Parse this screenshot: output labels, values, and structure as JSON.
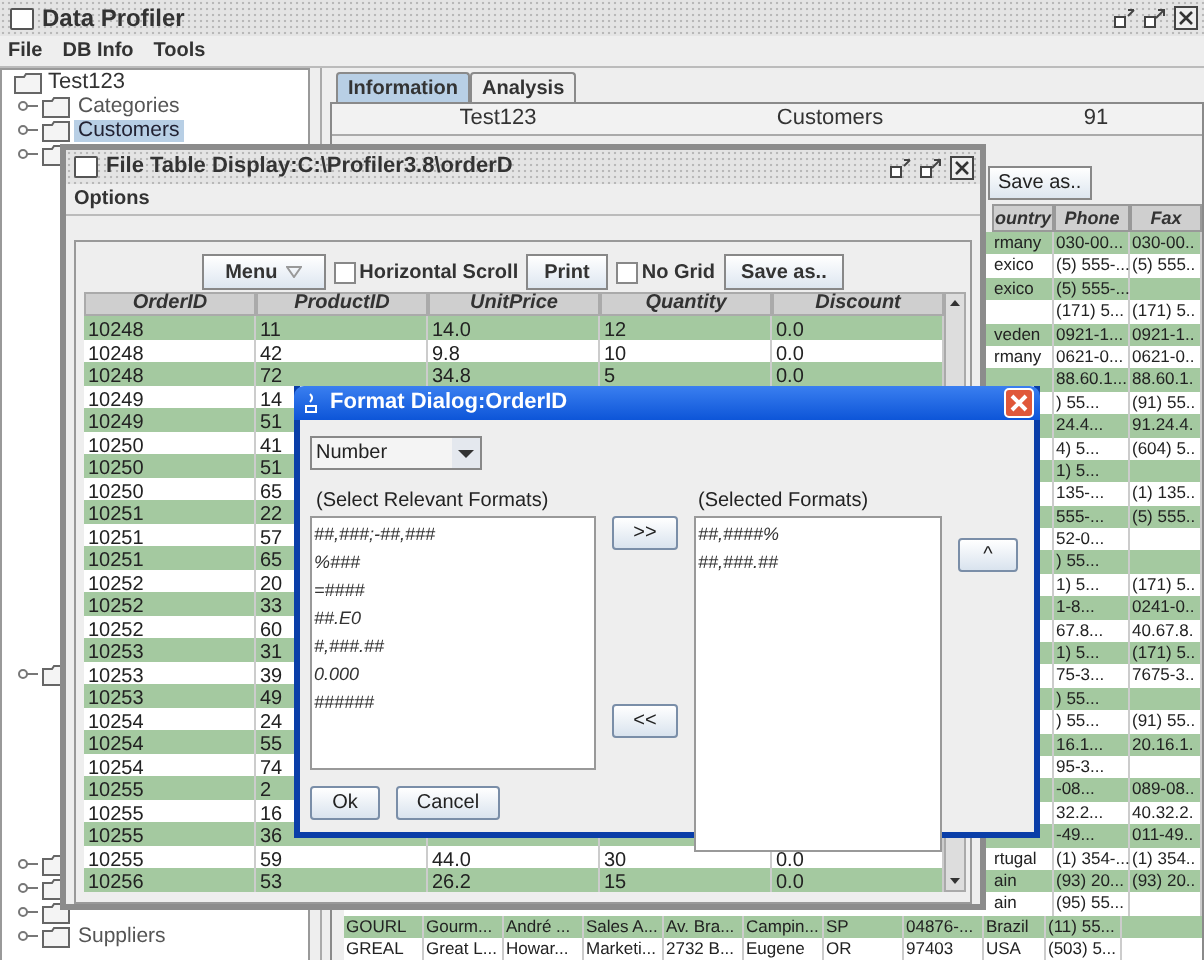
{
  "window": {
    "title": "Data Profiler"
  },
  "menu": [
    "File",
    "DB Info",
    "Tools"
  ],
  "tree": {
    "label": "Test123",
    "children": [
      {
        "label": "Categories",
        "selected": false
      },
      {
        "label": "Customers",
        "selected": true
      },
      {
        "selected": false
      },
      {
        "selected": false
      },
      {
        "selected": false
      },
      {
        "selected": false
      },
      {
        "selected": false
      },
      {
        "label": "Suppliers",
        "selected": false
      }
    ]
  },
  "info_tabs": [
    {
      "label": "Information",
      "selected": true
    },
    {
      "label": "Analysis",
      "selected": false
    }
  ],
  "summary": [
    "Test123",
    "Customers",
    "91"
  ],
  "customer_table": {
    "save_button": "Save as..",
    "columns": [
      "ountry",
      "Phone",
      "Fax"
    ],
    "rows": [
      {
        "country": "rmany",
        "phone": "030-00...",
        "fax": "030-00.."
      },
      {
        "country": "exico",
        "phone": "(5) 555-...",
        "fax": "(5) 555.."
      },
      {
        "country": "exico",
        "phone": "(5) 555-..."
      },
      {
        "phone": "(171) 5...",
        "fax": "(171) 5.."
      },
      {
        "country": "veden",
        "phone": "0921-1...",
        "fax": "0921-1.."
      },
      {
        "country": "rmany",
        "phone": "0621-0...",
        "fax": "0621-0.."
      },
      {
        "phone": "88.60.1...",
        "fax": "88.60.1."
      },
      {
        "phone": ") 55...",
        "fax": "(91) 55.."
      },
      {
        "phone": "24.4...",
        "fax": "91.24.4."
      },
      {
        "phone": "4) 5...",
        "fax": "(604) 5.."
      },
      {
        "phone": "1) 5..."
      },
      {
        "phone": "135-...",
        "fax": "(1) 135.."
      },
      {
        "phone": "555-...",
        "fax": "(5) 555.."
      },
      {
        "phone": "52-0..."
      },
      {
        "phone": ") 55..."
      },
      {
        "phone": "1) 5...",
        "fax": "(171) 5.."
      },
      {
        "phone": "1-8...",
        "fax": "0241-0.."
      },
      {
        "phone": "67.8...",
        "fax": "40.67.8."
      },
      {
        "phone": "1) 5...",
        "fax": "(171) 5.."
      },
      {
        "phone": "75-3...",
        "fax": "7675-3.."
      },
      {
        "phone": ") 55..."
      },
      {
        "phone": ") 55...",
        "fax": "(91) 55.."
      },
      {
        "phone": "16.1...",
        "fax": "20.16.1."
      },
      {
        "phone": "95-3..."
      },
      {
        "phone": "-08...",
        "fax": "089-08.."
      },
      {
        "phone": "32.2...",
        "fax": "40.32.2."
      },
      {
        "phone": "-49...",
        "fax": "011-49.."
      },
      {
        "country": "rtugal",
        "phone": "(1) 354-...",
        "fax": "(1) 354.."
      },
      {
        "country": "ain",
        "phone": "(93) 20...",
        "fax": "(93) 20.."
      },
      {
        "country": "ain",
        "phone": "(95) 55..."
      }
    ],
    "full_rows": [
      [
        "GOURL",
        "Gourm...",
        "André ...",
        "Sales A...",
        "Av. Bra...",
        "Campin...",
        "SP",
        "04876-...",
        "Brazil",
        "(11) 55..."
      ],
      [
        "GREAL",
        "Great L...",
        "Howar...",
        "Marketi...",
        "2732 B...",
        "Eugene",
        "OR",
        "97403",
        "USA",
        "(503) 5..."
      ]
    ]
  },
  "table_frame": {
    "title": "File Table Display:C:\\Profiler3.8\\orderD",
    "menu": "Options",
    "toolbar": [
      {
        "kind": "menu",
        "label": "Menu"
      },
      {
        "kind": "check",
        "label": "Horizontal Scroll",
        "checked": false
      },
      {
        "kind": "button",
        "label": "Print"
      },
      {
        "kind": "check",
        "label": "No Grid",
        "checked": false
      },
      {
        "kind": "button",
        "label": "Save as.."
      }
    ],
    "columns": [
      "OrderID",
      "ProductID",
      "UnitPrice",
      "Quantity",
      "Discount"
    ],
    "rows": [
      [
        "10248",
        "11",
        "14.0",
        "12",
        "0.0"
      ],
      [
        "10248",
        "42",
        "9.8",
        "10",
        "0.0"
      ],
      [
        "10248",
        "72",
        "34.8",
        "5",
        "0.0"
      ],
      [
        "10249",
        "14"
      ],
      [
        "10249",
        "51"
      ],
      [
        "10250",
        "41"
      ],
      [
        "10250",
        "51"
      ],
      [
        "10250",
        "65"
      ],
      [
        "10251",
        "22"
      ],
      [
        "10251",
        "57"
      ],
      [
        "10251",
        "65"
      ],
      [
        "10252",
        "20"
      ],
      [
        "10252",
        "33"
      ],
      [
        "10252",
        "60"
      ],
      [
        "10253",
        "31"
      ],
      [
        "10253",
        "39"
      ],
      [
        "10253",
        "49"
      ],
      [
        "10254",
        "24"
      ],
      [
        "10254",
        "55"
      ],
      [
        "10254",
        "74"
      ],
      [
        "10255",
        "2"
      ],
      [
        "10255",
        "16"
      ],
      [
        "10255",
        "36"
      ],
      [
        "10255",
        "59",
        "44.0",
        "30",
        "0.0"
      ],
      [
        "10256",
        "53",
        "26.2",
        "15",
        "0.0"
      ]
    ]
  },
  "format_dialog": {
    "title": "Format Dialog:OrderID",
    "type": "Number",
    "left_label": "(Select Relevant Formats)",
    "right_label": "(Selected Formats)",
    "available": [
      "##,###;-##,###",
      "%###",
      "=####",
      "##.E0",
      "#,###.##",
      "0.000",
      "######"
    ],
    "selected_formats": [
      "##,####%",
      "##,###.##"
    ],
    "add_button": ">>",
    "remove_button": "<<",
    "up_button": "^",
    "ok": "Ok",
    "cancel": "Cancel"
  }
}
